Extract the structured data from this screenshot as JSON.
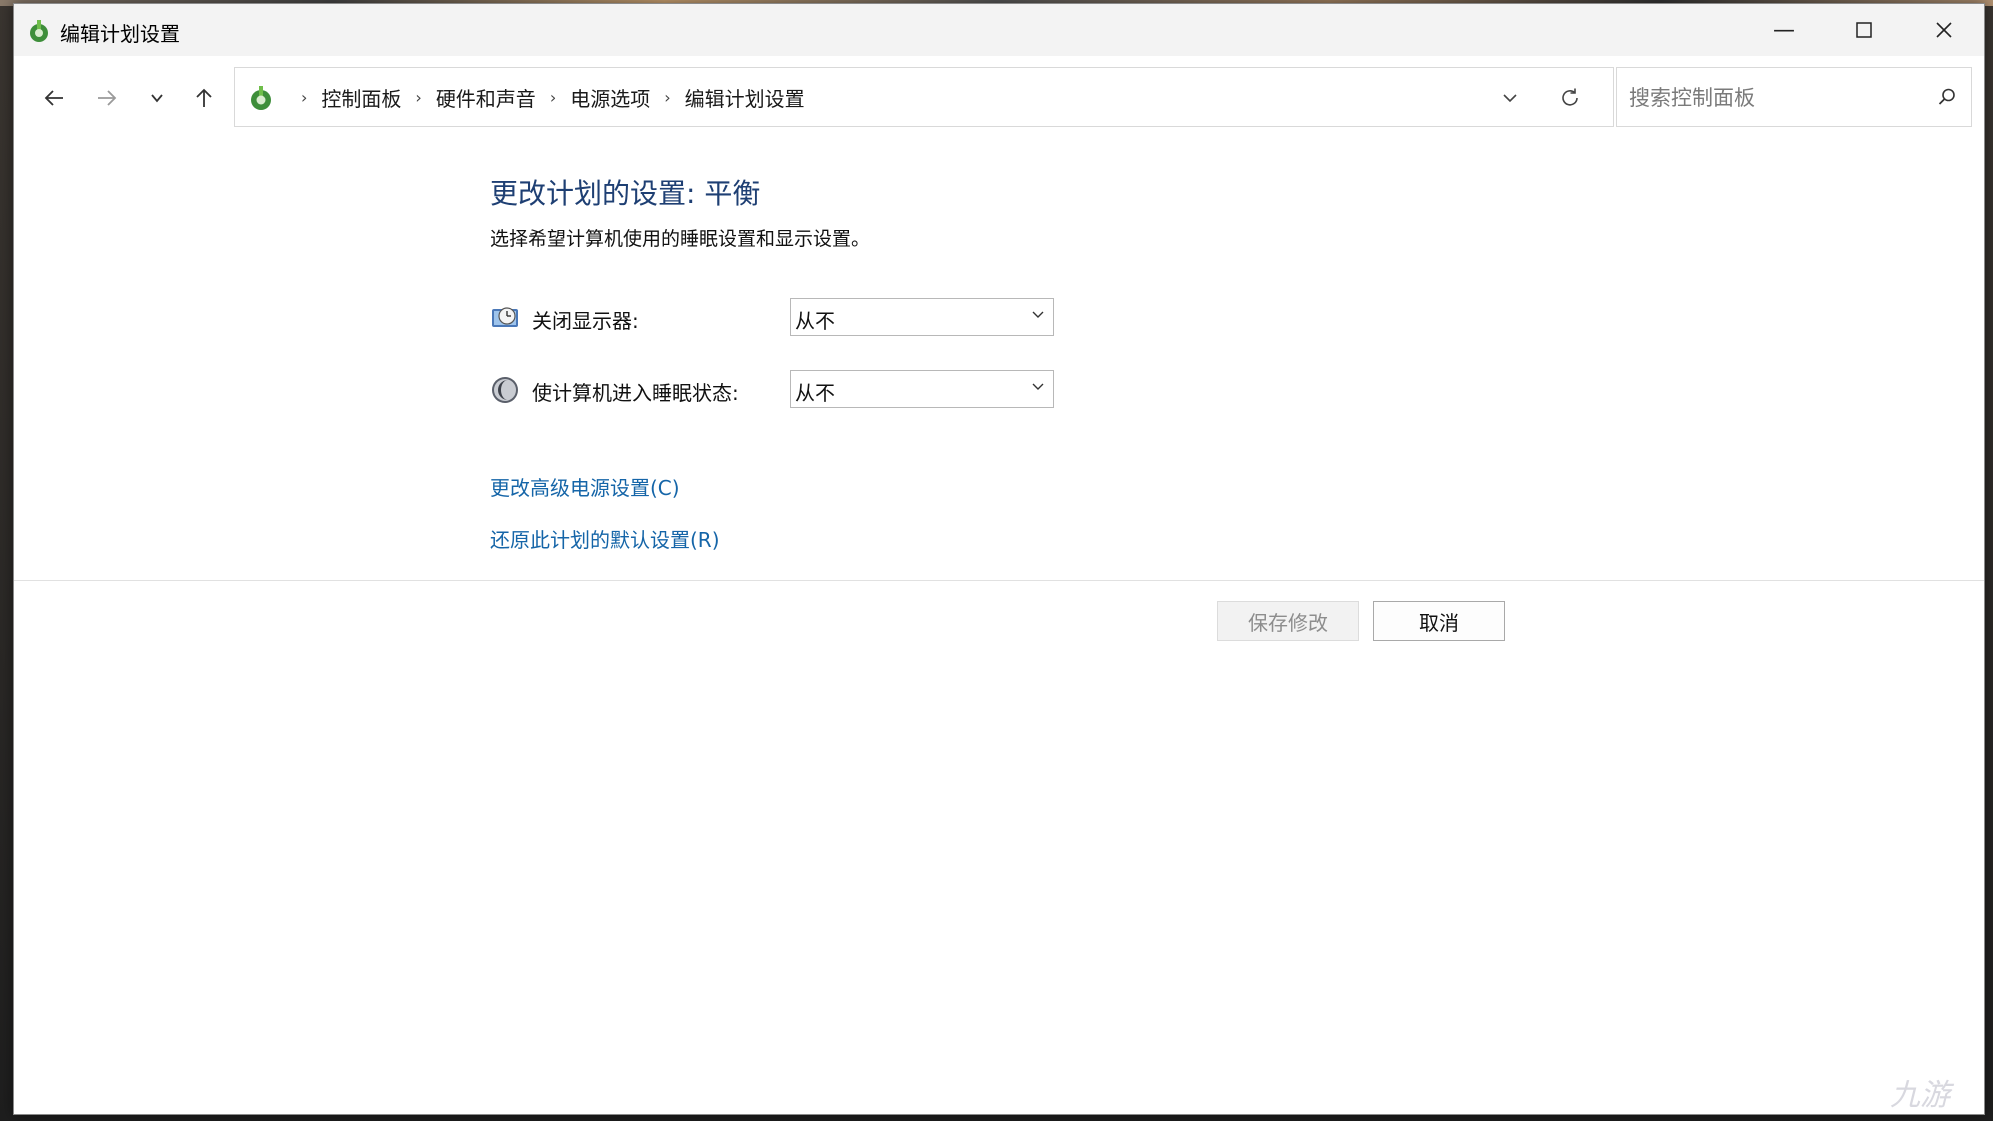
{
  "window": {
    "title": "编辑计划设置"
  },
  "titlebar": {
    "minimize_icon": "minimize-icon",
    "maximize_icon": "maximize-icon",
    "close_icon": "close-icon"
  },
  "nav": {
    "back_icon": "arrow-left-icon",
    "forward_icon": "arrow-right-icon",
    "recent_icon": "chevron-down-icon",
    "up_icon": "arrow-up-icon"
  },
  "breadcrumb": {
    "items": [
      {
        "label": "控制面板"
      },
      {
        "label": "硬件和声音"
      },
      {
        "label": "电源选项"
      },
      {
        "label": "编辑计划设置"
      }
    ],
    "separator": "›"
  },
  "search": {
    "placeholder": "搜索控制面板",
    "value": ""
  },
  "main": {
    "title": "更改计划的设置: 平衡",
    "subtitle": "选择希望计算机使用的睡眠设置和显示设置。",
    "settings": [
      {
        "label": "关闭显示器:",
        "value": "从不",
        "icon": "monitor-clock-icon"
      },
      {
        "label": "使计算机进入睡眠状态:",
        "value": "从不",
        "icon": "moon-icon"
      }
    ],
    "links": {
      "advanced": "更改高级电源设置(C)",
      "restore": "还原此计划的默认设置(R)"
    }
  },
  "footer": {
    "save_label": "保存修改",
    "cancel_label": "取消"
  },
  "colors": {
    "title": "#1e3f73",
    "link": "#1565a8",
    "disabled_text": "#8d8d8d"
  },
  "watermark": "九游"
}
